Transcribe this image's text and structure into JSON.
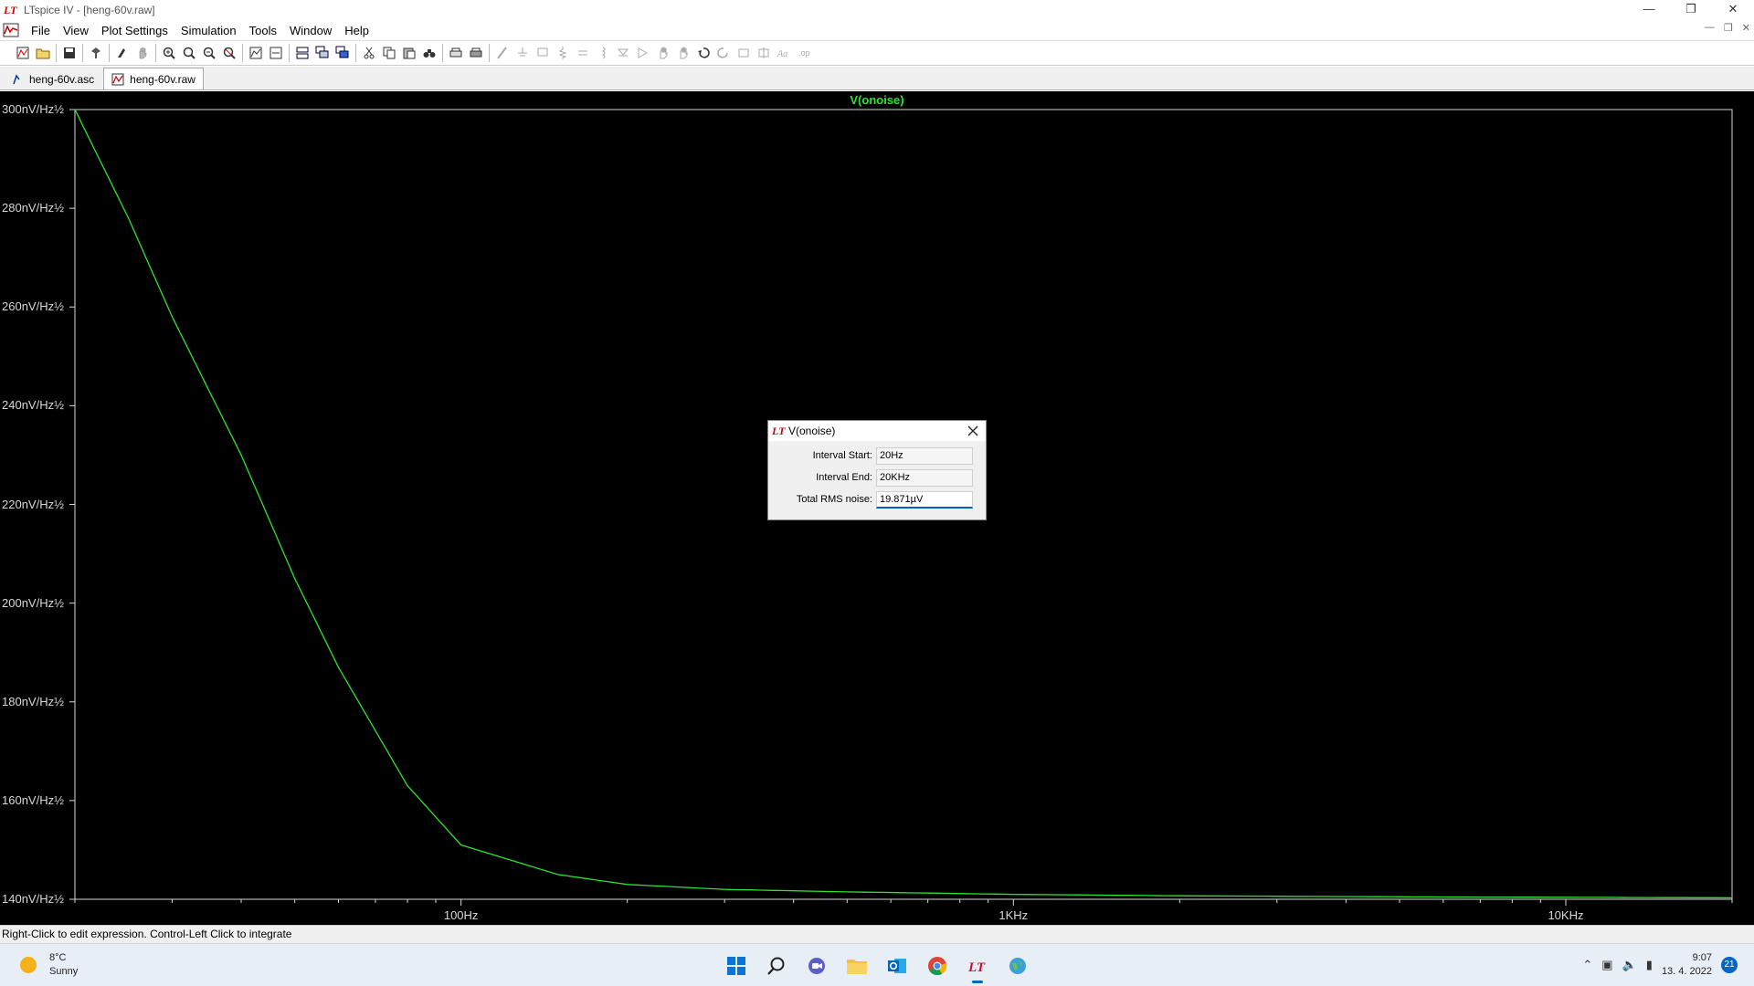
{
  "window": {
    "title": "LTspice IV - [heng-60v.raw]"
  },
  "menu": [
    "File",
    "View",
    "Plot Settings",
    "Simulation",
    "Tools",
    "Window",
    "Help"
  ],
  "tabs": [
    {
      "label": "heng-60v.asc",
      "active": false
    },
    {
      "label": "heng-60v.raw",
      "active": true
    }
  ],
  "plot": {
    "trace_name": "V(onoise)",
    "trace_color": "#2ee32e"
  },
  "chart_data": {
    "type": "line",
    "title": "V(onoise)",
    "x_scale": "log",
    "xlim": [
      20,
      20000
    ],
    "ylim": [
      140,
      300
    ],
    "x_ticks": [
      100,
      1000,
      10000
    ],
    "x_tick_labels": [
      "100Hz",
      "1KHz",
      "10KHz"
    ],
    "y_ticks": [
      300,
      280,
      260,
      240,
      220,
      200,
      180,
      160,
      140
    ],
    "y_tick_labels": [
      "300nV/Hz½",
      "280nV/Hz½",
      "260nV/Hz½",
      "240nV/Hz½",
      "220nV/Hz½",
      "200nV/Hz½",
      "180nV/Hz½",
      "160nV/Hz½",
      "140nV/Hz½"
    ],
    "series": [
      {
        "name": "V(onoise)",
        "x": [
          20,
          25,
          30,
          40,
          50,
          60,
          80,
          100,
          150,
          200,
          300,
          500,
          1000,
          2000,
          5000,
          10000,
          20000
        ],
        "y": [
          300,
          278,
          258,
          230,
          205,
          187,
          163,
          151,
          145,
          143,
          142,
          141.5,
          141,
          140.7,
          140.5,
          140.4,
          140.3
        ]
      }
    ],
    "grid": false
  },
  "dialog": {
    "title": "V(onoise)",
    "fields": [
      {
        "label": "Interval Start:",
        "value": "20Hz"
      },
      {
        "label": "Interval End:",
        "value": "20KHz"
      },
      {
        "label": "Total RMS noise:",
        "value": "19.871µV"
      }
    ]
  },
  "status": {
    "text": "Right-Click to edit expression. Control-Left Click to integrate"
  },
  "taskbar": {
    "weather": {
      "temp": "8°C",
      "condition": "Sunny"
    },
    "clock": {
      "time": "9:07",
      "date": "13. 4. 2022"
    },
    "notifications": "21"
  },
  "colors": {
    "plot_bg": "#000000",
    "axis": "#d8d8d8",
    "trace": "#2ee32e",
    "accent": "#0067c0"
  }
}
